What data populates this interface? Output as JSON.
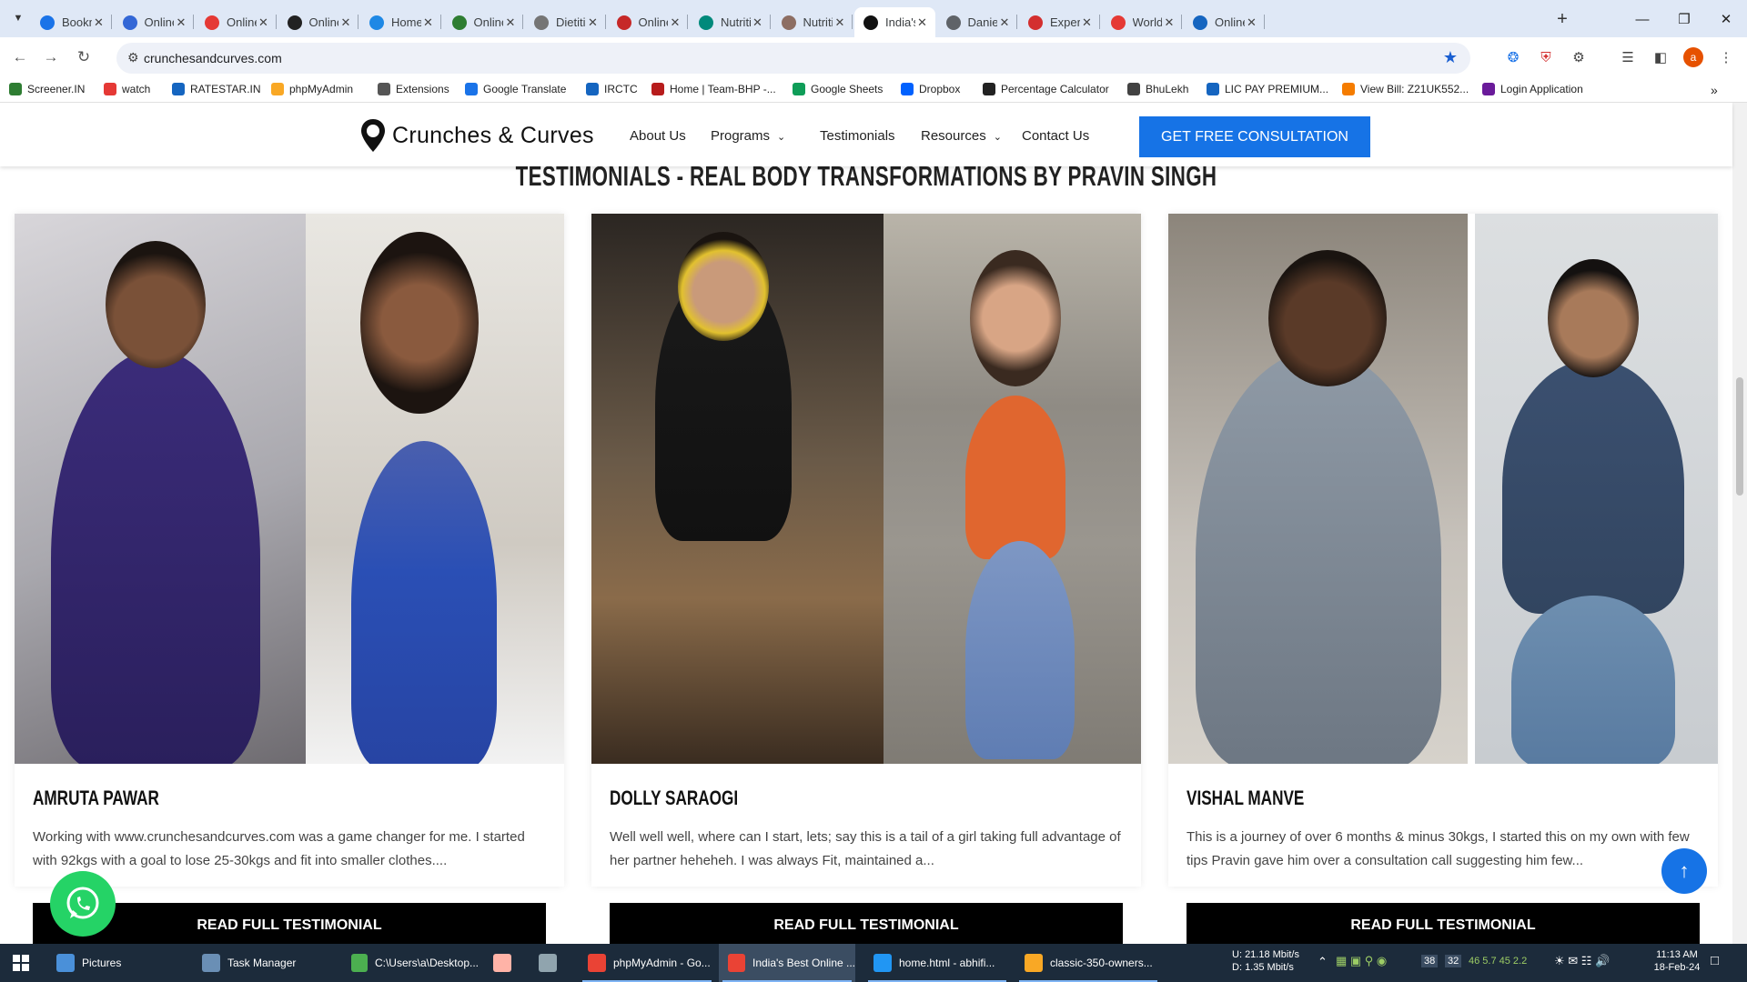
{
  "browser": {
    "tabs": [
      {
        "label": "Bookm",
        "color": "#1a73e8"
      },
      {
        "label": "Online",
        "color": "#3367d6"
      },
      {
        "label": "Online",
        "color": "#e53935"
      },
      {
        "label": "Online",
        "color": "#222222"
      },
      {
        "label": "Home |",
        "color": "#1e88e5"
      },
      {
        "label": "Online",
        "color": "#2e7d32"
      },
      {
        "label": "Dietitia",
        "color": "#757575"
      },
      {
        "label": "Online",
        "color": "#c62828"
      },
      {
        "label": "Nutritic",
        "color": "#00897b"
      },
      {
        "label": "Nutritic",
        "color": "#8d6e63"
      },
      {
        "label": "India's",
        "color": "#111111"
      },
      {
        "label": "Daniel",
        "color": "#5f6368"
      },
      {
        "label": "Experie",
        "color": "#d32f2f"
      },
      {
        "label": "World",
        "color": "#e53935"
      },
      {
        "label": "Online",
        "color": "#1565c0"
      }
    ],
    "active_tab_index": 10,
    "url": "crunchesandcurves.com",
    "bookmarks": [
      {
        "label": "Screener.IN",
        "color": "#2e7d32"
      },
      {
        "label": "watch",
        "color": "#e53935"
      },
      {
        "label": "RATESTAR.IN",
        "color": "#1565c0"
      },
      {
        "label": "phpMyAdmin",
        "color": "#f9a825"
      },
      {
        "label": "Extensions",
        "color": "#555555"
      },
      {
        "label": "Google Translate",
        "color": "#1a73e8"
      },
      {
        "label": "IRCTC",
        "color": "#1565c0"
      },
      {
        "label": "Home | Team-BHP -...",
        "color": "#b71c1c"
      },
      {
        "label": "Google Sheets",
        "color": "#0f9d58"
      },
      {
        "label": "Dropbox",
        "color": "#0061fe"
      },
      {
        "label": "Percentage Calculator",
        "color": "#222222"
      },
      {
        "label": "BhuLekh",
        "color": "#424242"
      },
      {
        "label": "LIC PAY PREMIUM...",
        "color": "#1565c0"
      },
      {
        "label": "View Bill: Z21UK552...",
        "color": "#f57c00"
      },
      {
        "label": "Login Application",
        "color": "#6a1b9a"
      }
    ]
  },
  "site": {
    "logo_text": "Crunches & Curves",
    "nav": {
      "about": "About Us",
      "programs": "Programs",
      "testimonials": "Testimonials",
      "resources": "Resources",
      "contact": "Contact Us"
    },
    "cta": "GET FREE CONSULTATION",
    "heading": "TESTIMONIALS - REAL BODY TRANSFORMATIONS BY PRAVIN SINGH",
    "cards": [
      {
        "name": "AMRUTA PAWAR",
        "desc": "Working with www.crunchesandcurves.com was a game changer for me. I started with 92kgs with a goal to lose 25-30kgs and fit into smaller clothes....",
        "button": "READ FULL TESTIMONIAL"
      },
      {
        "name": "DOLLY SARAOGI",
        "desc": "Well well well, where can I start, lets; say this is a tail of a girl taking full advantage of her partner heheheh. I was always Fit, maintained a...",
        "button": "READ FULL TESTIMONIAL"
      },
      {
        "name": "VISHAL MANVE",
        "desc": "This is a journey of over 6 months & minus 30kgs, I started this on my own with few tips Pravin gave him over a consultation call suggesting him few...",
        "button": "READ FULL TESTIMONIAL"
      }
    ]
  },
  "taskbar": {
    "items": [
      {
        "label": "Pictures"
      },
      {
        "label": "Task Manager"
      },
      {
        "label": "C:\\Users\\a\\Desktop..."
      },
      {
        "label": ""
      },
      {
        "label": ""
      },
      {
        "label": "phpMyAdmin - Go..."
      },
      {
        "label": "India's Best Online ..."
      },
      {
        "label": "home.html - abhifi..."
      },
      {
        "label": "classic-350-owners..."
      }
    ],
    "net_up": "U:",
    "net_up_val": "21.18 Mbit/s",
    "net_down": "D:",
    "net_down_val": "1.35 Mbit/s",
    "tray_nums": "46  5.7  45  2.2",
    "badge1": "38",
    "badge2": "32",
    "time": "11:13 AM",
    "date": "18-Feb-24"
  }
}
